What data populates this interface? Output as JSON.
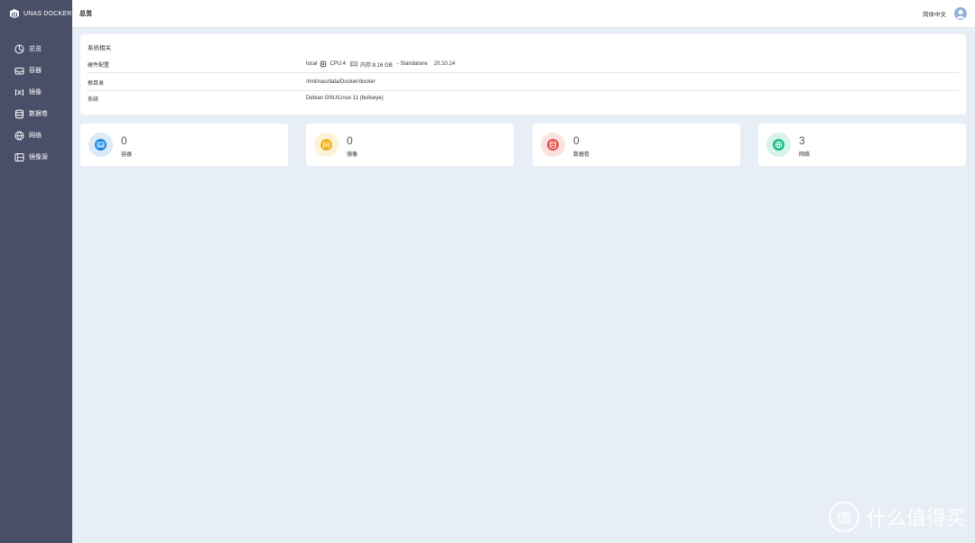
{
  "brand": {
    "name": "UNAS DOCKER"
  },
  "sidebar": {
    "items": [
      {
        "label": "总览",
        "icon": "dashboard-icon"
      },
      {
        "label": "容器",
        "icon": "container-icon"
      },
      {
        "label": "镜像",
        "icon": "image-icon"
      },
      {
        "label": "数据卷",
        "icon": "volume-icon"
      },
      {
        "label": "网络",
        "icon": "network-icon"
      },
      {
        "label": "镜像源",
        "icon": "registry-icon"
      }
    ]
  },
  "header": {
    "title": "总览",
    "language": "简体中文"
  },
  "system": {
    "section_title": "系统相关",
    "hardware_label": "硬件配置",
    "host": "local",
    "cpu": "CPU:4",
    "memory": "内存:8.16 GB",
    "mode": "- Standalone",
    "version": "20.10.14",
    "dir_label": "根目录",
    "dir_value": "/mnt/nas/data/Docker/docker",
    "os_label": "系统",
    "os_value": "Debian GNU/Linux 11 (bullseye)"
  },
  "stats": [
    {
      "value": "0",
      "label": "容器",
      "color": "#1e88e5",
      "bg": "#dbeaf8"
    },
    {
      "value": "0",
      "label": "镜像",
      "color": "#f0b429",
      "bg": "#fdf1d8"
    },
    {
      "value": "0",
      "label": "数据卷",
      "color": "#e5534b",
      "bg": "#fbe1df"
    },
    {
      "value": "3",
      "label": "网络",
      "color": "#21c08b",
      "bg": "#d7f4e9"
    }
  ],
  "watermark": {
    "text": "什么值得买",
    "mark": "值"
  }
}
